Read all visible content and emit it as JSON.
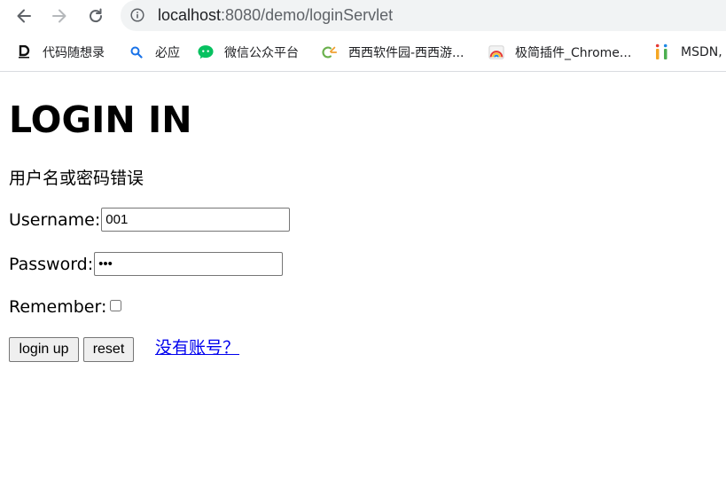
{
  "browser": {
    "url_host": "localhost",
    "url_path": ":8080/demo/loginServlet",
    "bookmarks": [
      {
        "label": "代码随想录",
        "icon": "code-logo-icon",
        "color": "#111111"
      },
      {
        "label": "必应",
        "icon": "search-icon",
        "color": "#1a73e8"
      },
      {
        "label": "微信公众平台",
        "icon": "wechat-icon",
        "color": "#07c160"
      },
      {
        "label": "西西软件园-西西游...",
        "icon": "cr-logo-icon",
        "color": "#6ab04c"
      },
      {
        "label": "极简插件_Chrome...",
        "icon": "rainbow-icon",
        "color": "#e53935"
      },
      {
        "label": "MSDN,",
        "icon": "msdn-logo-icon",
        "color": "#f5a623"
      }
    ]
  },
  "page": {
    "title": "LOGIN IN",
    "error_message": "用户名或密码错误",
    "username_label": "Username:",
    "username_value": "001",
    "password_label": "Password:",
    "password_value": "123",
    "remember_label": "Remember:",
    "remember_checked": false,
    "login_button": "login up",
    "reset_button": "reset",
    "register_link": "没有账号？"
  }
}
